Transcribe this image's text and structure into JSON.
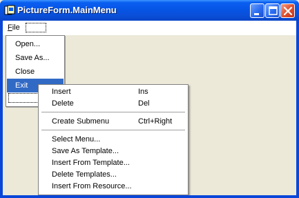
{
  "window": {
    "title": "PictureForm.MainMenu",
    "buttons": [
      "minimize",
      "maximize",
      "close"
    ]
  },
  "menubar": {
    "file_label_u": "F",
    "file_label_rest": "ile"
  },
  "file_menu": {
    "items": [
      "Open...",
      "Save As...",
      "Close",
      "Exit"
    ],
    "selected": "Exit"
  },
  "context_menu": {
    "items": [
      {
        "label": "Insert",
        "shortcut": "Ins"
      },
      {
        "label": "Delete",
        "shortcut": "Del"
      },
      {
        "label": "Create Submenu",
        "shortcut": "Ctrl+Right"
      },
      {
        "label": "Select Menu...",
        "shortcut": ""
      },
      {
        "label": "Save As Template...",
        "shortcut": ""
      },
      {
        "label": "Insert From Template...",
        "shortcut": ""
      },
      {
        "label": "Delete Templates...",
        "shortcut": ""
      },
      {
        "label": "Insert From Resource...",
        "shortcut": ""
      }
    ]
  },
  "colors": {
    "titlebar": "#0a5ff0",
    "selection": "#316ac5",
    "client": "#ece9d8"
  },
  "icons": [
    "app-icon",
    "minimize-icon",
    "maximize-icon",
    "close-icon"
  ]
}
